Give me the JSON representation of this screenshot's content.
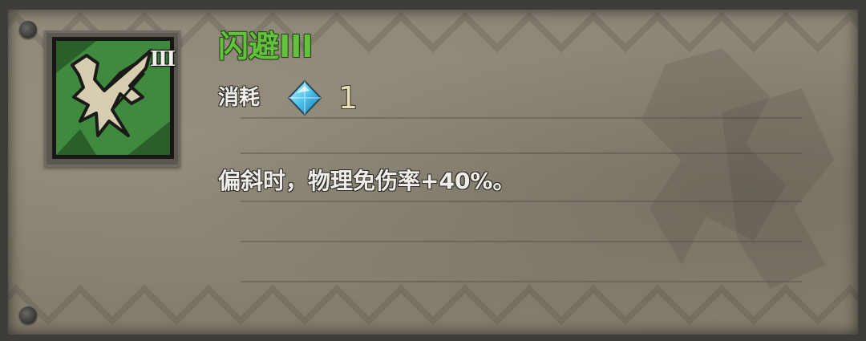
{
  "skill": {
    "tier_badge": "III",
    "title": "闪避III",
    "cost_label": "消耗",
    "cost_value": "1",
    "cost_icon": "blue-crystal-icon",
    "description": "偏斜时，物理免伤率+40%。"
  },
  "colors": {
    "title_green": "#63c13e",
    "icon_bg_green": "#3f8a3f",
    "panel_parchment": "#8a8474",
    "border_dark": "#3f3d39"
  },
  "icons": {
    "skill_icon": "dodge-skill-icon"
  }
}
